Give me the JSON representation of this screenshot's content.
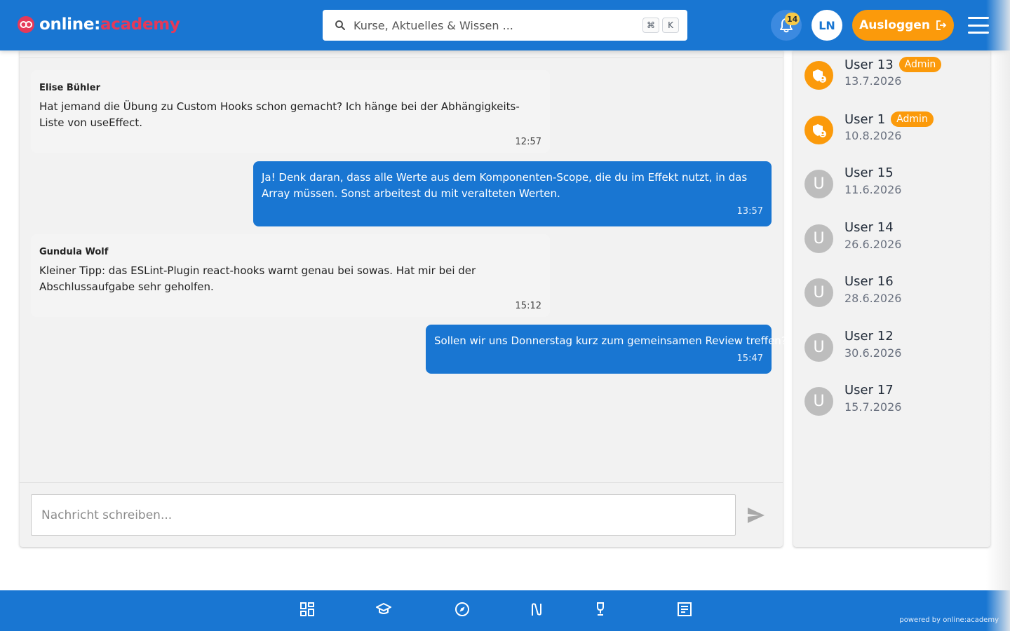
{
  "header": {
    "logo": {
      "part1": "online",
      "colon": ":",
      "part2": "academy"
    },
    "search": {
      "placeholder": "Kurse, Aktuelles & Wissen ...",
      "shortcut_key1": "⌘",
      "shortcut_key2": "K"
    },
    "notifications": {
      "count": "14",
      "icon": "bell-icon"
    },
    "avatar_initials": "LN",
    "logout_label": "Ausloggen"
  },
  "chat": {
    "messages": [
      {
        "direction": "in",
        "author": "Elise Bühler",
        "text": "Hat jemand die Übung zu Custom Hooks schon gemacht? Ich hänge bei der Abhängigkeits-Liste von useEffect.",
        "time": "12:57"
      },
      {
        "direction": "out",
        "text": "Ja! Denk daran, dass alle Werte aus dem Komponenten-Scope, die du im Effekt nutzt, in das Array müssen. Sonst arbeitest du mit veralteten Werten.",
        "time": "13:57"
      },
      {
        "direction": "in",
        "author": "Gundula Wolf",
        "text": "Kleiner Tipp: das ESLint-Plugin react-hooks warnt genau bei sowas. Hat mir bei der Abschlussaufgabe sehr geholfen.",
        "time": "15:12"
      },
      {
        "direction": "out",
        "text": "Sollen wir uns Donnerstag kurz zum gemeinsamen Review treffen?",
        "time": "15:47"
      }
    ],
    "composer_placeholder": "Nachricht schreiben..."
  },
  "members": [
    {
      "name": "User 13",
      "badge": "Admin",
      "date": "13.7.2026",
      "avatar": "admin-shield"
    },
    {
      "name": "User 1",
      "badge": "Admin",
      "date": "10.8.2026",
      "avatar": "admin-shield"
    },
    {
      "name": "User 15",
      "badge": "",
      "date": "11.6.2026",
      "avatar": "U"
    },
    {
      "name": "User 14",
      "badge": "",
      "date": "26.6.2026",
      "avatar": "U"
    },
    {
      "name": "User 16",
      "badge": "",
      "date": "28.6.2026",
      "avatar": "U"
    },
    {
      "name": "User 12",
      "badge": "",
      "date": "30.6.2026",
      "avatar": "U"
    },
    {
      "name": "User 17",
      "badge": "",
      "date": "15.7.2026",
      "avatar": "U"
    }
  ],
  "bottom_nav": {
    "icons": [
      "dashboard-icon",
      "graduation-cap-icon",
      "compass-icon",
      "route-icon",
      "trophy-icon",
      "article-icon"
    ],
    "powered_by": "powered by online:academy"
  },
  "colors": {
    "primary": "#1976d2",
    "accent_orange": "#fb9a0b",
    "brand_red": "#e53959",
    "panel_bg": "#f2f2f2"
  }
}
